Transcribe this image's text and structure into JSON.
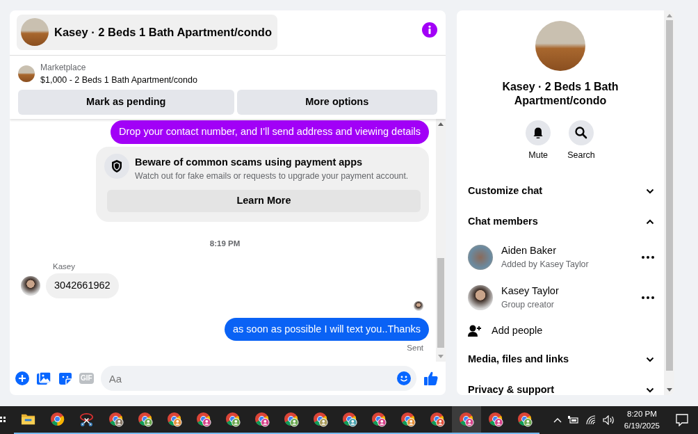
{
  "conversation": {
    "title": "Kasey · 2 Beds 1 Bath Apartment/condo"
  },
  "listing": {
    "source": "Marketplace",
    "summary": "$1,000 - 2 Beds 1 Bath Apartment/condo",
    "actions": [
      "Mark as pending",
      "More options"
    ]
  },
  "messages": [
    {
      "kind": "outgoing",
      "text": "Drop your contact number, and I'll send address and viewing details",
      "color": "#a200f7"
    },
    {
      "kind": "notice",
      "title": "Beware of common scams using payment apps",
      "body": "Watch out for fake emails or requests to upgrade your payment account.",
      "action": "Learn More"
    },
    {
      "kind": "timestamp",
      "text": "8:19 PM"
    },
    {
      "kind": "incoming",
      "sender": "Kasey",
      "text": "3042661962"
    },
    {
      "kind": "seen"
    },
    {
      "kind": "outgoing",
      "text": "as soon as possible I will text you..Thanks",
      "color": "#0a62f5",
      "status": "Sent"
    }
  ],
  "composer": {
    "gif_label": "GIF",
    "placeholder": "Aa"
  },
  "details": {
    "title": "Kasey · 2 Beds 1 Bath Apartment/condo",
    "actions": [
      {
        "kind": "mute",
        "label": "Mute"
      },
      {
        "kind": "search",
        "label": "Search"
      }
    ],
    "sections": [
      {
        "label": "Customize chat",
        "expanded": false
      },
      {
        "label": "Chat members",
        "expanded": true,
        "members": [
          {
            "name": "Aiden Baker",
            "note": "Added by Kasey Taylor"
          },
          {
            "name": "Kasey Taylor",
            "note": "Group creator"
          }
        ],
        "add_label": "Add people"
      },
      {
        "label": "Media, files and links",
        "expanded": false
      },
      {
        "label": "Privacy & support",
        "expanded": false
      }
    ]
  },
  "taskbar": {
    "apps": [
      {
        "kind": "explorer",
        "selected": false
      },
      {
        "kind": "browser",
        "selected": false
      },
      {
        "kind": "snip",
        "selected": false
      },
      {
        "kind": "profile",
        "color": "#8a7a6a",
        "selected": false
      },
      {
        "kind": "profile",
        "color": "#6aa84f",
        "selected": false
      },
      {
        "kind": "profile",
        "color": "#e6913a",
        "selected": false
      },
      {
        "kind": "profile",
        "color": "#d6418a",
        "selected": false
      },
      {
        "kind": "profile",
        "color": "#6aa84f",
        "selected": false
      },
      {
        "kind": "profile",
        "color": "#d6418a",
        "selected": false
      },
      {
        "kind": "profile",
        "color": "#6aa84f",
        "selected": false
      },
      {
        "kind": "profile",
        "color": "#a89a5a",
        "selected": false
      },
      {
        "kind": "profile",
        "color": "#4aa3b0",
        "selected": false
      },
      {
        "kind": "profile",
        "color": "#d6418a",
        "selected": false
      },
      {
        "kind": "profile",
        "color": "#e6913a",
        "selected": false
      },
      {
        "kind": "profile",
        "color": "#e0503a",
        "selected": false
      },
      {
        "kind": "profile",
        "color": "#d6418a",
        "selected": true
      },
      {
        "kind": "profile",
        "color": "#d6418a",
        "selected": false
      },
      {
        "kind": "profile",
        "color": "#6aa84f",
        "selected": false
      }
    ],
    "time": "8:20 PM",
    "date": "6/19/2025"
  }
}
